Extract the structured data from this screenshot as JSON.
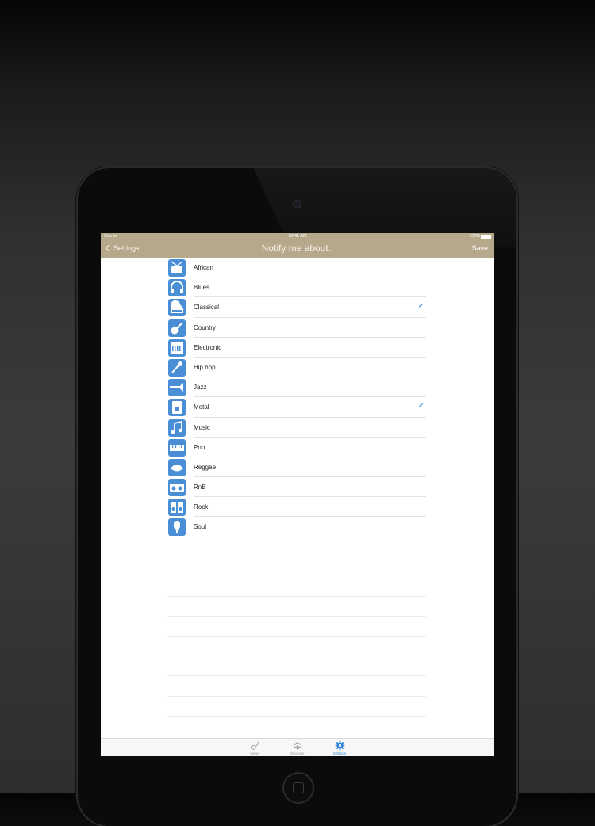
{
  "status": {
    "carrier": "Carrier",
    "time": "10:41 AM",
    "battery": "100%"
  },
  "nav": {
    "back_label": "Settings",
    "title": "Notify me about..",
    "save_label": "Save"
  },
  "genres": [
    {
      "label": "African",
      "icon": "drum-icon",
      "checked": false
    },
    {
      "label": "Blues",
      "icon": "headphones-icon",
      "checked": false
    },
    {
      "label": "Classical",
      "icon": "piano-icon",
      "checked": true
    },
    {
      "label": "Country",
      "icon": "guitar-icon",
      "checked": false
    },
    {
      "label": "Electronic",
      "icon": "synthesizer-icon",
      "checked": false
    },
    {
      "label": "Hip hop",
      "icon": "microphone-icon",
      "checked": false
    },
    {
      "label": "Jazz",
      "icon": "trumpet-icon",
      "checked": false
    },
    {
      "label": "Metal",
      "icon": "amplifier-icon",
      "checked": true
    },
    {
      "label": "Music",
      "icon": "music-note-icon",
      "checked": false
    },
    {
      "label": "Pop",
      "icon": "keyboard-icon",
      "checked": false
    },
    {
      "label": "Reggae",
      "icon": "hat-icon",
      "checked": false
    },
    {
      "label": "RnB",
      "icon": "boombox-icon",
      "checked": false
    },
    {
      "label": "Rock",
      "icon": "speakers-icon",
      "checked": false
    },
    {
      "label": "Soul",
      "icon": "vintage-microphone-icon",
      "checked": false
    }
  ],
  "checkmark": "✓",
  "tabs": [
    {
      "label": "News",
      "icon": "guitar-outline-icon",
      "active": false
    },
    {
      "label": "Discover",
      "icon": "cloud-download-icon",
      "active": false
    },
    {
      "label": "Settings",
      "icon": "gear-icon",
      "active": true
    }
  ],
  "colors": {
    "nav_background": "#b6a88a",
    "accent": "#2f86d8",
    "icon_blue": "#4a8fd6"
  }
}
